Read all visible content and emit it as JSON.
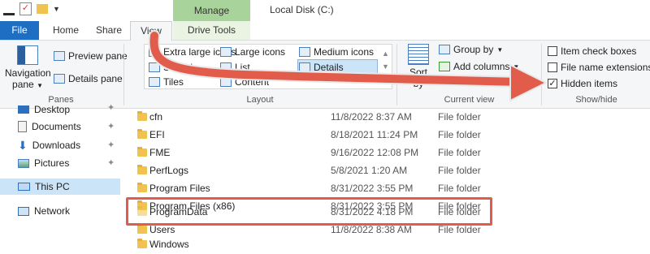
{
  "window": {
    "title": "Local Disk (C:)"
  },
  "tabs": {
    "file": "File",
    "home": "Home",
    "share": "Share",
    "view": "View",
    "manage": "Manage",
    "drive_tools": "Drive Tools"
  },
  "ribbon": {
    "panes": {
      "navigation_pane": "Navigation",
      "navigation_pane_sub": "pane",
      "preview_pane": "Preview pane",
      "details_pane": "Details pane",
      "label": "Panes"
    },
    "layout": {
      "extra_large": "Extra large icons",
      "large": "Large icons",
      "medium": "Medium icons",
      "small": "Small ic",
      "list": "List",
      "details": "Details",
      "tiles": "Tiles",
      "content": "Content",
      "label": "Layout"
    },
    "current_view": {
      "sort": "Sort",
      "sort_sub": "by",
      "group_by": "Group by",
      "add_columns": "Add columns",
      "label": "Current view"
    },
    "show_hide": {
      "item_check_boxes": "Item check boxes",
      "file_name_extensions": "File name extensions",
      "hidden_items": "Hidden items",
      "hidden_items_checked": "✓",
      "label": "Show/hide"
    }
  },
  "nav": {
    "items": [
      {
        "label": "Desktop"
      },
      {
        "label": "Documents"
      },
      {
        "label": "Downloads"
      },
      {
        "label": "Pictures"
      },
      {
        "label": "This PC"
      },
      {
        "label": "Network"
      }
    ]
  },
  "files": [
    {
      "name": "cfn",
      "date": "11/8/2022 8:37 AM",
      "type": "File folder"
    },
    {
      "name": "EFI",
      "date": "8/18/2021 11:24 PM",
      "type": "File folder"
    },
    {
      "name": "FME",
      "date": "9/16/2022 12:08 PM",
      "type": "File folder"
    },
    {
      "name": "PerfLogs",
      "date": "5/8/2021 1:20 AM",
      "type": "File folder"
    },
    {
      "name": "Program Files",
      "date": "8/31/2022 3:55 PM",
      "type": "File folder"
    },
    {
      "name": "Program Files (x86)",
      "date": "8/31/2022 3:55 PM",
      "type": "File folder"
    },
    {
      "name": "ProgramData",
      "date": "8/31/2022 4:18 PM",
      "type": "File folder"
    },
    {
      "name": "Users",
      "date": "11/8/2022 8:38 AM",
      "type": "File folder"
    },
    {
      "name": "Windows",
      "date": "",
      "type": ""
    }
  ],
  "colors": {
    "accent": "#1e6fc4",
    "manage": "#a8d39a",
    "annotation": "#e25c4c"
  }
}
